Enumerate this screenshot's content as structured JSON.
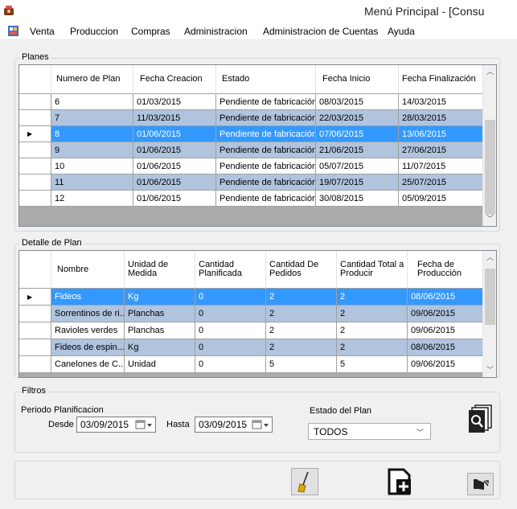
{
  "window": {
    "title": "Menú Principal  - [Consu"
  },
  "menu": [
    "Venta",
    "Produccion",
    "Compras",
    "Administracion",
    "Administracion de Cuentas",
    "Ayuda"
  ],
  "planes": {
    "label": "Planes",
    "columns": [
      "Numero de Plan",
      "Fecha Creacion",
      "Estado",
      "Fecha Inicio",
      "Fecha Finalización"
    ],
    "rows": [
      [
        "6",
        "01/03/2015",
        "Pendiente de fabricación",
        "08/03/2015",
        "14/03/2015"
      ],
      [
        "7",
        "11/03/2015",
        "Pendiente de fabricación",
        "22/03/2015",
        "28/03/2015"
      ],
      [
        "8",
        "01/06/2015",
        "Pendiente de fabricación",
        "07/06/2015",
        "13/06/2015"
      ],
      [
        "9",
        "01/06/2015",
        "Pendiente de fabricación",
        "21/06/2015",
        "27/06/2015"
      ],
      [
        "10",
        "01/06/2015",
        "Pendiente de fabricación",
        "05/07/2015",
        "11/07/2015"
      ],
      [
        "11",
        "01/06/2015",
        "Pendiente de fabricación",
        "19/07/2015",
        "25/07/2015"
      ],
      [
        "12",
        "01/06/2015",
        "Pendiente de fabricación",
        "30/08/2015",
        "05/09/2015"
      ]
    ],
    "selected_row": 2
  },
  "detalle": {
    "label": "Detalle de Plan",
    "columns": [
      "Nombre",
      "Unidad de Medida",
      "Cantidad Planificada",
      "Cantidad De Pedidos",
      "Cantidad Total a Producir",
      "Fecha de Producción"
    ],
    "rows": [
      [
        "Fideos",
        "Kg",
        "0",
        "2",
        "2",
        "08/06/2015"
      ],
      [
        "Sorrentinos de ri...",
        "Planchas",
        "0",
        "2",
        "2",
        "09/06/2015"
      ],
      [
        "Ravioles verdes",
        "Planchas",
        "0",
        "2",
        "2",
        "09/06/2015"
      ],
      [
        "Fideos de espin...",
        "Kg",
        "0",
        "2",
        "2",
        "08/06/2015"
      ],
      [
        "Canelones de C...",
        "Unidad",
        "0",
        "5",
        "5",
        "09/06/2015"
      ]
    ],
    "selected_row": 0
  },
  "filtros": {
    "label": "Filtros",
    "periodo_label": "Periodo Planificacion",
    "desde_label": "Desde",
    "desde_value": "03/09/2015",
    "hasta_label": "Hasta",
    "hasta_value": "03/09/2015",
    "estado_label": "Estado del Plan",
    "estado_value": "TODOS"
  },
  "colors": {
    "selected": "#3399ff",
    "alt_row": "#b0c4de",
    "row": "#ffffff",
    "grid_bg": "#ababab"
  },
  "icons": [
    "search-icon",
    "broom-icon",
    "add-document-icon",
    "exit-icon"
  ]
}
